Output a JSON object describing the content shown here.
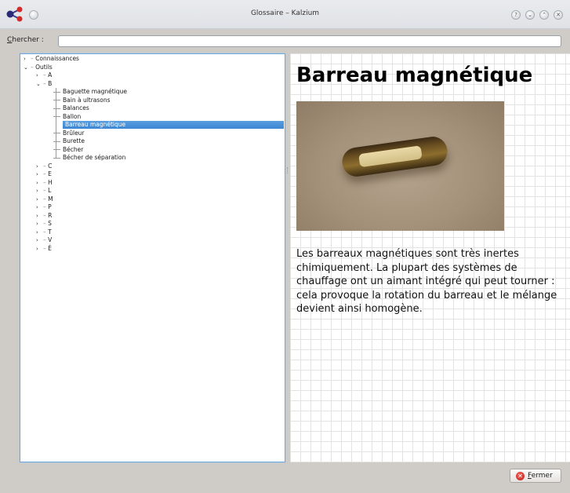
{
  "window": {
    "title": "Glossaire – Kalzium",
    "buttons": {
      "help": "?",
      "minimize": "⌄",
      "maximize": "⌃",
      "close": "✕"
    }
  },
  "search": {
    "label_mnemonic": "C",
    "label_rest": "hercher :",
    "value": "",
    "placeholder": ""
  },
  "tree": {
    "items": [
      {
        "level": 0,
        "arrow": "›",
        "label": "Connaissances"
      },
      {
        "level": 0,
        "arrow": "⌄",
        "label": "Outils"
      },
      {
        "level": 1,
        "arrow": "›",
        "label": "A"
      },
      {
        "level": 1,
        "arrow": "⌄",
        "label": "B"
      },
      {
        "level": 2,
        "arrow": "",
        "label": "Baguette magnétique"
      },
      {
        "level": 2,
        "arrow": "",
        "label": "Bain à ultrasons"
      },
      {
        "level": 2,
        "arrow": "",
        "label": "Balances"
      },
      {
        "level": 2,
        "arrow": "",
        "label": "Ballon"
      },
      {
        "level": 2,
        "arrow": "",
        "label": "Barreau magnétique",
        "selected": true
      },
      {
        "level": 2,
        "arrow": "",
        "label": "Brûleur"
      },
      {
        "level": 2,
        "arrow": "",
        "label": "Burette"
      },
      {
        "level": 2,
        "arrow": "",
        "label": "Bécher"
      },
      {
        "level": 2,
        "arrow": "",
        "label": "Bécher de séparation"
      },
      {
        "level": 1,
        "arrow": "›",
        "label": "C"
      },
      {
        "level": 1,
        "arrow": "›",
        "label": "E"
      },
      {
        "level": 1,
        "arrow": "›",
        "label": "H"
      },
      {
        "level": 1,
        "arrow": "›",
        "label": "L"
      },
      {
        "level": 1,
        "arrow": "›",
        "label": "M"
      },
      {
        "level": 1,
        "arrow": "›",
        "label": "P"
      },
      {
        "level": 1,
        "arrow": "›",
        "label": "R"
      },
      {
        "level": 1,
        "arrow": "›",
        "label": "S"
      },
      {
        "level": 1,
        "arrow": "›",
        "label": "T"
      },
      {
        "level": 1,
        "arrow": "›",
        "label": "V"
      },
      {
        "level": 1,
        "arrow": "›",
        "label": "É"
      }
    ]
  },
  "entry": {
    "title": "Barreau magnétique",
    "image": "magnetic-stir-bar-photo",
    "description": "Les barreaux magnétiques sont très inertes chimiquement. La plupart des systèmes de chauffage ont un aimant intégré qui peut tourner : cela provoque la rotation du barreau et le mélange devient ainsi homogène."
  },
  "footer": {
    "close_mnemonic": "F",
    "close_rest": "ermer",
    "close_icon": "close-icon"
  },
  "colors": {
    "selection": "#3d86d3",
    "focus_border": "#6aa7df",
    "window_bg": "#cfcbc6"
  }
}
